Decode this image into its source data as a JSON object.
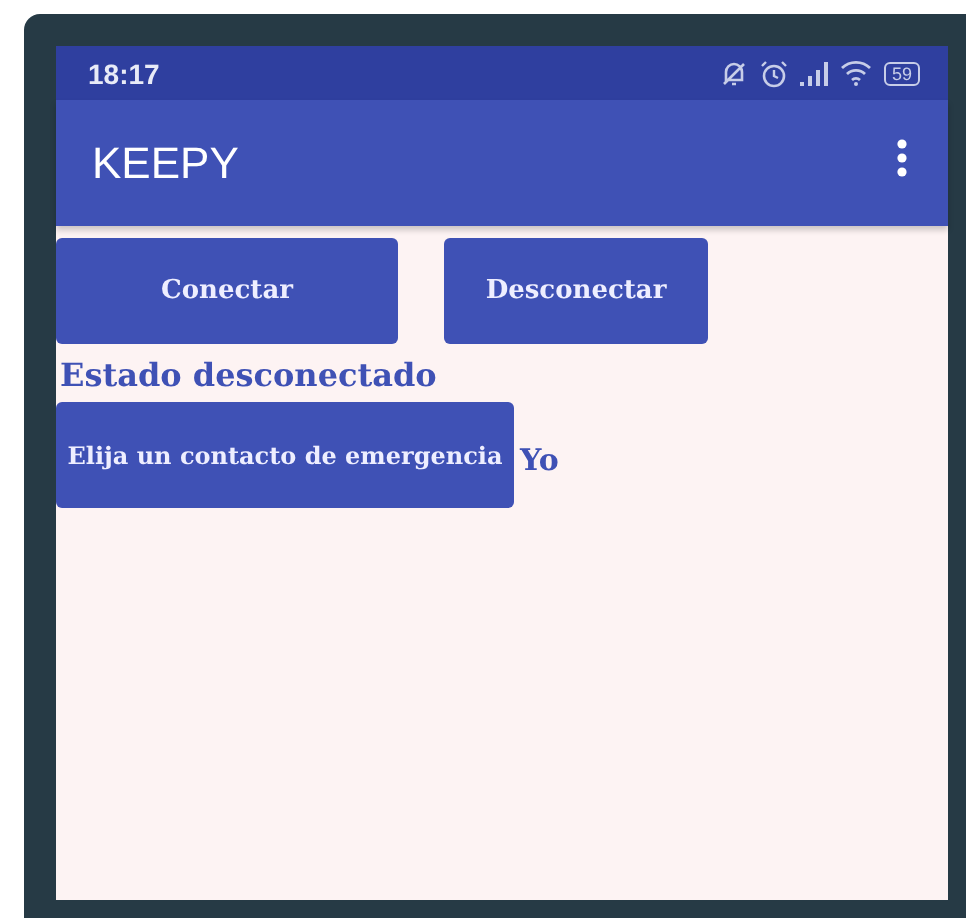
{
  "status_bar": {
    "time": "18:17",
    "battery": "59"
  },
  "app_bar": {
    "title": "KEEPY"
  },
  "buttons": [
    {
      "label": "Conectar"
    },
    {
      "label": "Desconectar"
    }
  ],
  "status_text": "Estado desconectado",
  "contact": {
    "button": "Elija un contacto de emergencia",
    "value": "Yo"
  }
}
